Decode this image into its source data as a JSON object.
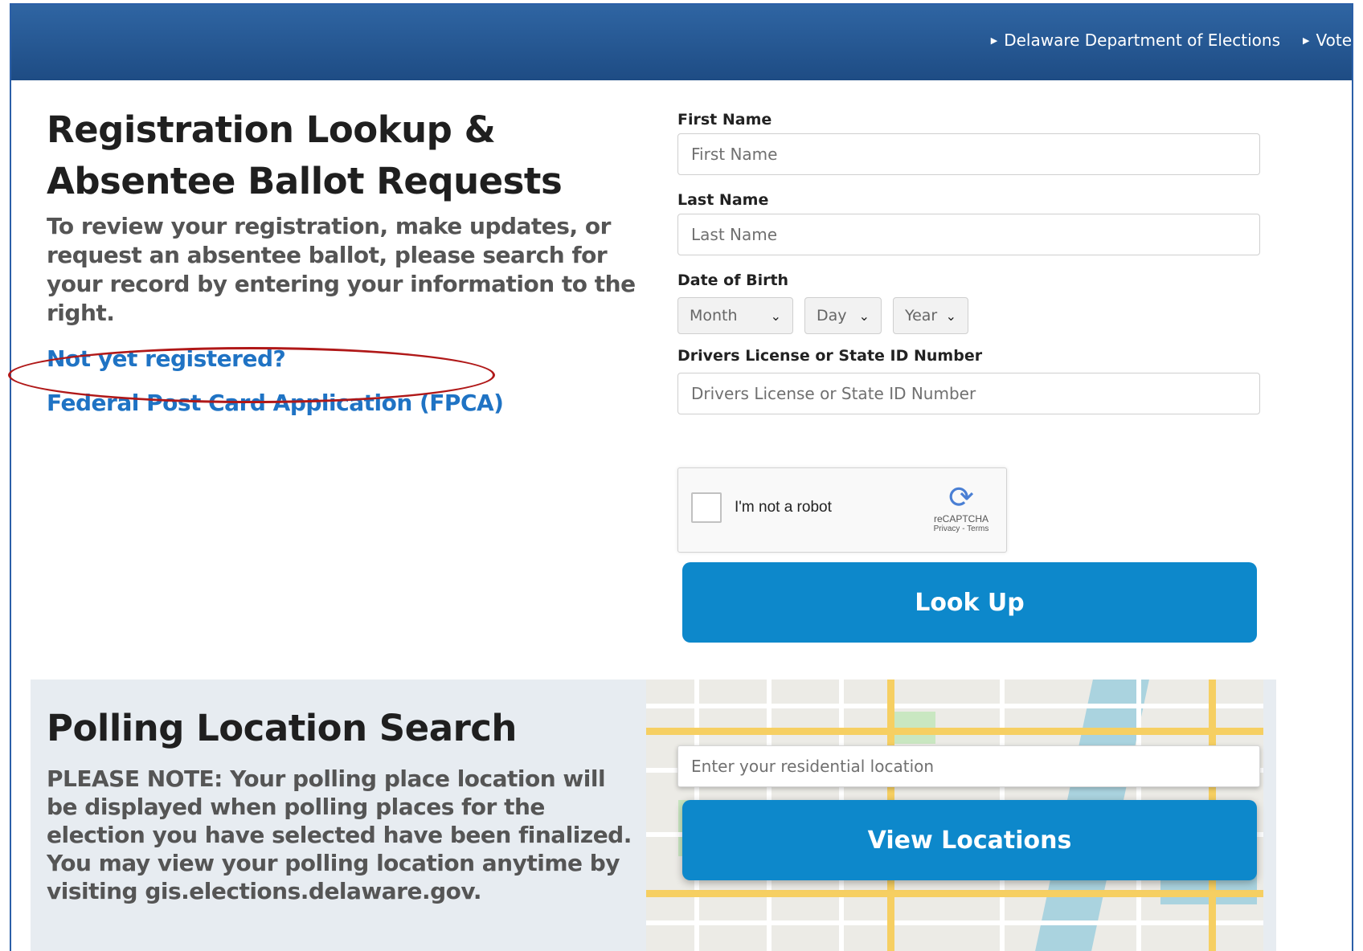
{
  "topnav": {
    "items": [
      {
        "label": "Delaware Department of Elections"
      },
      {
        "label": "Vote"
      }
    ]
  },
  "registration": {
    "title_line1": "Registration Lookup &",
    "title_line2": "Absentee Ballot Requests",
    "intro": "To review your registration, make updates, or request an absentee ballot, please search for your record by entering your information to the right.",
    "link_register": "Not yet registered?",
    "link_fpca": "Federal Post Card Application (FPCA)"
  },
  "form": {
    "first_name_label": "First Name",
    "first_name_placeholder": "First Name",
    "last_name_label": "Last Name",
    "last_name_placeholder": "Last Name",
    "dob_label": "Date of Birth",
    "month": "Month",
    "day": "Day",
    "year": "Year",
    "license_label": "Drivers License or State ID Number",
    "license_placeholder": "Drivers License or State ID Number",
    "lookup_button": "Look Up"
  },
  "captcha": {
    "text": "I'm not a robot",
    "brand": "reCAPTCHA",
    "terms": "Privacy - Terms"
  },
  "polling": {
    "title": "Polling Location Search",
    "note": "PLEASE NOTE: Your polling place location will be displayed when polling places for the election you have selected have been finalized. You may view your polling location anytime by visiting gis.elections.delaware.gov.",
    "location_placeholder": "Enter your residential location",
    "view_button": "View Locations"
  },
  "colors": {
    "header": "#2a5b97",
    "button": "#0d88cb",
    "link": "#1f73c4",
    "highlight_ellipse": "#b01818",
    "polling_bg": "#e7ecf1"
  }
}
